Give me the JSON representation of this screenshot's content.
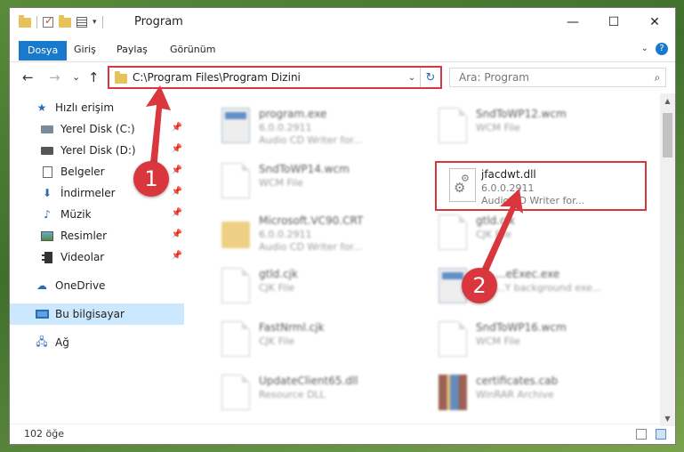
{
  "window": {
    "title": "Program"
  },
  "titlebar": {
    "minimize": "—",
    "maximize": "☐",
    "close": "✕"
  },
  "ribbon": {
    "tabs": [
      {
        "label": "Dosya"
      },
      {
        "label": "Giriş"
      },
      {
        "label": "Paylaş"
      },
      {
        "label": "Görünüm"
      }
    ],
    "help": "?"
  },
  "nav": {
    "back": "←",
    "forward": "→",
    "recent": "⌄",
    "up": "↑"
  },
  "address": {
    "path": "C:\\Program Files\\Program Dizini"
  },
  "search": {
    "placeholder": "Ara: Program"
  },
  "sidebar": {
    "items": [
      {
        "label": "Hızlı erişim"
      },
      {
        "label": "Yerel Disk (C:)"
      },
      {
        "label": "Yerel Disk (D:)"
      },
      {
        "label": "Belgeler"
      },
      {
        "label": "İndirmeler"
      },
      {
        "label": "Müzik"
      },
      {
        "label": "Resimler"
      },
      {
        "label": "Videolar"
      },
      {
        "label": "OneDrive"
      },
      {
        "label": "Bu bilgisayar"
      },
      {
        "label": "Ağ"
      }
    ]
  },
  "files": [
    {
      "name": "program.exe",
      "line2": "6.0.0.2911",
      "line3": "Audio CD Writer for..."
    },
    {
      "name": "SndToWP12.wcm",
      "line2": "WCM File",
      "line3": ""
    },
    {
      "name": "SndToWP14.wcm",
      "line2": "WCM File",
      "line3": ""
    },
    {
      "name": "jfacdwt.dll",
      "line2": "6.0.0.2911",
      "line3": "Audio CD Writer for..."
    },
    {
      "name": "Microsoft.VC90.CRT",
      "line2": "6.0.0.2911",
      "line3": "Audio CD Writer for..."
    },
    {
      "name": "gtld.cjk",
      "line2": "CJK File",
      "line3": ""
    },
    {
      "name": "gtld.cjk",
      "line2": "CJK File",
      "line3": ""
    },
    {
      "name": "...eExec.exe",
      "line2": "...Y background exe...",
      "line3": ""
    },
    {
      "name": "FastNrml.cjk",
      "line2": "CJK File",
      "line3": ""
    },
    {
      "name": "SndToWP16.wcm",
      "line2": "WCM File",
      "line3": ""
    },
    {
      "name": "UpdateClient65.dll",
      "line2": "Resource DLL",
      "line3": ""
    },
    {
      "name": "certificates.cab",
      "line2": "WinRAR Archive",
      "line3": ""
    }
  ],
  "status": {
    "count": "102 öğe"
  },
  "annotations": {
    "step1": "1",
    "step2": "2"
  },
  "colors": {
    "accent": "#1979ca",
    "highlight": "#d9363e"
  }
}
